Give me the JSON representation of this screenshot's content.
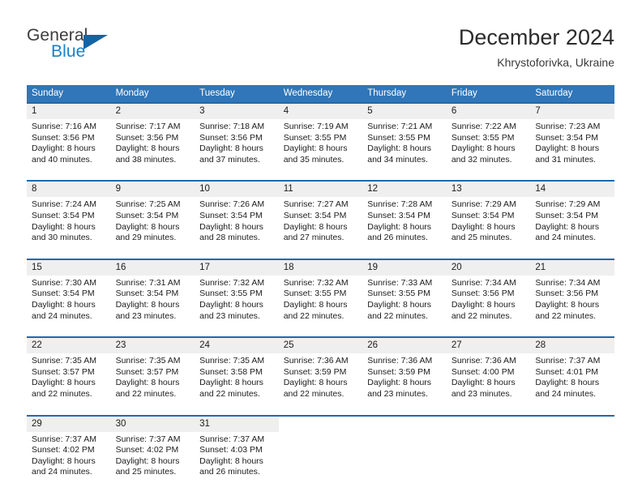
{
  "brand": {
    "line1": "General",
    "line2": "Blue",
    "mark": "triangle-logo-mark"
  },
  "header": {
    "title": "December 2024",
    "location": "Khrystoforivka, Ukraine"
  },
  "colors": {
    "header_blue": "#3076b8",
    "row_rule_blue": "#1f69ad",
    "daynum_band": "#efefef",
    "brand_blue": "#1c7fc4",
    "text": "#1c1c1c"
  },
  "calendar": {
    "weekday_headers": [
      "Sunday",
      "Monday",
      "Tuesday",
      "Wednesday",
      "Thursday",
      "Friday",
      "Saturday"
    ],
    "labels": {
      "sunrise_prefix": "Sunrise:",
      "sunset_prefix": "Sunset:",
      "daylight_prefix": "Daylight:"
    },
    "weeks": [
      [
        {
          "day": "1",
          "sunrise": "Sunrise: 7:16 AM",
          "sunset": "Sunset: 3:56 PM",
          "daylight_line1": "Daylight: 8 hours",
          "daylight_line2": "and 40 minutes."
        },
        {
          "day": "2",
          "sunrise": "Sunrise: 7:17 AM",
          "sunset": "Sunset: 3:56 PM",
          "daylight_line1": "Daylight: 8 hours",
          "daylight_line2": "and 38 minutes."
        },
        {
          "day": "3",
          "sunrise": "Sunrise: 7:18 AM",
          "sunset": "Sunset: 3:56 PM",
          "daylight_line1": "Daylight: 8 hours",
          "daylight_line2": "and 37 minutes."
        },
        {
          "day": "4",
          "sunrise": "Sunrise: 7:19 AM",
          "sunset": "Sunset: 3:55 PM",
          "daylight_line1": "Daylight: 8 hours",
          "daylight_line2": "and 35 minutes."
        },
        {
          "day": "5",
          "sunrise": "Sunrise: 7:21 AM",
          "sunset": "Sunset: 3:55 PM",
          "daylight_line1": "Daylight: 8 hours",
          "daylight_line2": "and 34 minutes."
        },
        {
          "day": "6",
          "sunrise": "Sunrise: 7:22 AM",
          "sunset": "Sunset: 3:55 PM",
          "daylight_line1": "Daylight: 8 hours",
          "daylight_line2": "and 32 minutes."
        },
        {
          "day": "7",
          "sunrise": "Sunrise: 7:23 AM",
          "sunset": "Sunset: 3:54 PM",
          "daylight_line1": "Daylight: 8 hours",
          "daylight_line2": "and 31 minutes."
        }
      ],
      [
        {
          "day": "8",
          "sunrise": "Sunrise: 7:24 AM",
          "sunset": "Sunset: 3:54 PM",
          "daylight_line1": "Daylight: 8 hours",
          "daylight_line2": "and 30 minutes."
        },
        {
          "day": "9",
          "sunrise": "Sunrise: 7:25 AM",
          "sunset": "Sunset: 3:54 PM",
          "daylight_line1": "Daylight: 8 hours",
          "daylight_line2": "and 29 minutes."
        },
        {
          "day": "10",
          "sunrise": "Sunrise: 7:26 AM",
          "sunset": "Sunset: 3:54 PM",
          "daylight_line1": "Daylight: 8 hours",
          "daylight_line2": "and 28 minutes."
        },
        {
          "day": "11",
          "sunrise": "Sunrise: 7:27 AM",
          "sunset": "Sunset: 3:54 PM",
          "daylight_line1": "Daylight: 8 hours",
          "daylight_line2": "and 27 minutes."
        },
        {
          "day": "12",
          "sunrise": "Sunrise: 7:28 AM",
          "sunset": "Sunset: 3:54 PM",
          "daylight_line1": "Daylight: 8 hours",
          "daylight_line2": "and 26 minutes."
        },
        {
          "day": "13",
          "sunrise": "Sunrise: 7:29 AM",
          "sunset": "Sunset: 3:54 PM",
          "daylight_line1": "Daylight: 8 hours",
          "daylight_line2": "and 25 minutes."
        },
        {
          "day": "14",
          "sunrise": "Sunrise: 7:29 AM",
          "sunset": "Sunset: 3:54 PM",
          "daylight_line1": "Daylight: 8 hours",
          "daylight_line2": "and 24 minutes."
        }
      ],
      [
        {
          "day": "15",
          "sunrise": "Sunrise: 7:30 AM",
          "sunset": "Sunset: 3:54 PM",
          "daylight_line1": "Daylight: 8 hours",
          "daylight_line2": "and 24 minutes."
        },
        {
          "day": "16",
          "sunrise": "Sunrise: 7:31 AM",
          "sunset": "Sunset: 3:54 PM",
          "daylight_line1": "Daylight: 8 hours",
          "daylight_line2": "and 23 minutes."
        },
        {
          "day": "17",
          "sunrise": "Sunrise: 7:32 AM",
          "sunset": "Sunset: 3:55 PM",
          "daylight_line1": "Daylight: 8 hours",
          "daylight_line2": "and 23 minutes."
        },
        {
          "day": "18",
          "sunrise": "Sunrise: 7:32 AM",
          "sunset": "Sunset: 3:55 PM",
          "daylight_line1": "Daylight: 8 hours",
          "daylight_line2": "and 22 minutes."
        },
        {
          "day": "19",
          "sunrise": "Sunrise: 7:33 AM",
          "sunset": "Sunset: 3:55 PM",
          "daylight_line1": "Daylight: 8 hours",
          "daylight_line2": "and 22 minutes."
        },
        {
          "day": "20",
          "sunrise": "Sunrise: 7:34 AM",
          "sunset": "Sunset: 3:56 PM",
          "daylight_line1": "Daylight: 8 hours",
          "daylight_line2": "and 22 minutes."
        },
        {
          "day": "21",
          "sunrise": "Sunrise: 7:34 AM",
          "sunset": "Sunset: 3:56 PM",
          "daylight_line1": "Daylight: 8 hours",
          "daylight_line2": "and 22 minutes."
        }
      ],
      [
        {
          "day": "22",
          "sunrise": "Sunrise: 7:35 AM",
          "sunset": "Sunset: 3:57 PM",
          "daylight_line1": "Daylight: 8 hours",
          "daylight_line2": "and 22 minutes."
        },
        {
          "day": "23",
          "sunrise": "Sunrise: 7:35 AM",
          "sunset": "Sunset: 3:57 PM",
          "daylight_line1": "Daylight: 8 hours",
          "daylight_line2": "and 22 minutes."
        },
        {
          "day": "24",
          "sunrise": "Sunrise: 7:35 AM",
          "sunset": "Sunset: 3:58 PM",
          "daylight_line1": "Daylight: 8 hours",
          "daylight_line2": "and 22 minutes."
        },
        {
          "day": "25",
          "sunrise": "Sunrise: 7:36 AM",
          "sunset": "Sunset: 3:59 PM",
          "daylight_line1": "Daylight: 8 hours",
          "daylight_line2": "and 22 minutes."
        },
        {
          "day": "26",
          "sunrise": "Sunrise: 7:36 AM",
          "sunset": "Sunset: 3:59 PM",
          "daylight_line1": "Daylight: 8 hours",
          "daylight_line2": "and 23 minutes."
        },
        {
          "day": "27",
          "sunrise": "Sunrise: 7:36 AM",
          "sunset": "Sunset: 4:00 PM",
          "daylight_line1": "Daylight: 8 hours",
          "daylight_line2": "and 23 minutes."
        },
        {
          "day": "28",
          "sunrise": "Sunrise: 7:37 AM",
          "sunset": "Sunset: 4:01 PM",
          "daylight_line1": "Daylight: 8 hours",
          "daylight_line2": "and 24 minutes."
        }
      ],
      [
        {
          "day": "29",
          "sunrise": "Sunrise: 7:37 AM",
          "sunset": "Sunset: 4:02 PM",
          "daylight_line1": "Daylight: 8 hours",
          "daylight_line2": "and 24 minutes."
        },
        {
          "day": "30",
          "sunrise": "Sunrise: 7:37 AM",
          "sunset": "Sunset: 4:02 PM",
          "daylight_line1": "Daylight: 8 hours",
          "daylight_line2": "and 25 minutes."
        },
        {
          "day": "31",
          "sunrise": "Sunrise: 7:37 AM",
          "sunset": "Sunset: 4:03 PM",
          "daylight_line1": "Daylight: 8 hours",
          "daylight_line2": "and 26 minutes."
        },
        {
          "day": "",
          "sunrise": "",
          "sunset": "",
          "daylight_line1": "",
          "daylight_line2": ""
        },
        {
          "day": "",
          "sunrise": "",
          "sunset": "",
          "daylight_line1": "",
          "daylight_line2": ""
        },
        {
          "day": "",
          "sunrise": "",
          "sunset": "",
          "daylight_line1": "",
          "daylight_line2": ""
        },
        {
          "day": "",
          "sunrise": "",
          "sunset": "",
          "daylight_line1": "",
          "daylight_line2": ""
        }
      ]
    ]
  }
}
